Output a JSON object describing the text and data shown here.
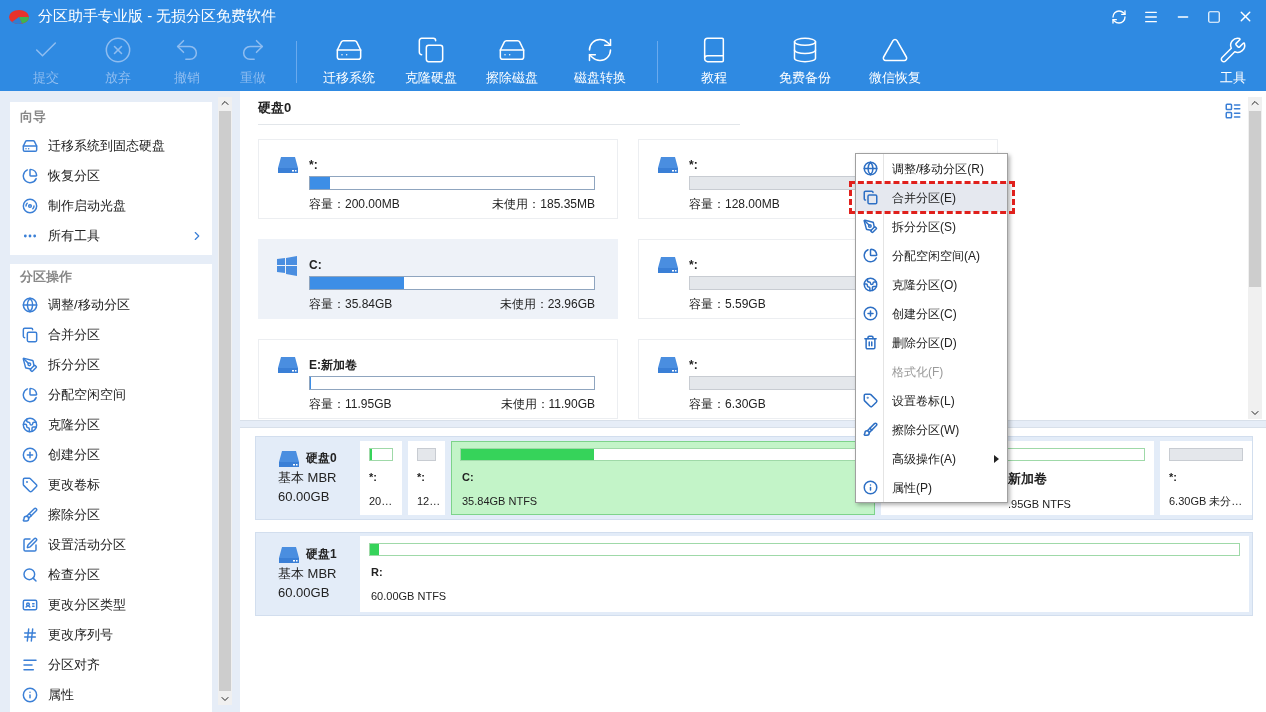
{
  "window": {
    "title": "分区助手专业版 - 无损分区免费软件"
  },
  "toolbar": {
    "groups": [
      [
        {
          "label": "提交",
          "disabled": true
        },
        {
          "label": "放弃",
          "disabled": true
        },
        {
          "label": "撤销",
          "disabled": true
        },
        {
          "label": "重做",
          "disabled": true
        }
      ],
      [
        {
          "label": "迁移系统",
          "disabled": false
        },
        {
          "label": "克隆硬盘",
          "disabled": false
        },
        {
          "label": "擦除磁盘",
          "disabled": false
        },
        {
          "label": "磁盘转换",
          "disabled": false
        }
      ],
      [
        {
          "label": "教程",
          "disabled": false
        },
        {
          "label": "免费备份",
          "disabled": false
        },
        {
          "label": "微信恢复",
          "disabled": false
        }
      ]
    ],
    "tools": {
      "label": "工具"
    }
  },
  "sidebar": {
    "sections": [
      {
        "title": "向导",
        "items": [
          {
            "label": "迁移系统到固态硬盘",
            "kind": "action"
          },
          {
            "label": "恢复分区",
            "kind": "action"
          },
          {
            "label": "制作启动光盘",
            "kind": "action"
          },
          {
            "label": "所有工具",
            "kind": "submenu"
          }
        ]
      },
      {
        "title": "分区操作",
        "items": [
          {
            "label": "调整/移动分区",
            "kind": "action"
          },
          {
            "label": "合并分区",
            "kind": "action"
          },
          {
            "label": "拆分分区",
            "kind": "action"
          },
          {
            "label": "分配空闲空间",
            "kind": "action"
          },
          {
            "label": "克隆分区",
            "kind": "action"
          },
          {
            "label": "创建分区",
            "kind": "action"
          },
          {
            "label": "更改卷标",
            "kind": "action"
          },
          {
            "label": "擦除分区",
            "kind": "action"
          },
          {
            "label": "设置活动分区",
            "kind": "action"
          },
          {
            "label": "检查分区",
            "kind": "action"
          },
          {
            "label": "更改分区类型",
            "kind": "action"
          },
          {
            "label": "更改序列号",
            "kind": "action"
          },
          {
            "label": "分区对齐",
            "kind": "action"
          },
          {
            "label": "属性",
            "kind": "action"
          }
        ]
      }
    ]
  },
  "disk_view": {
    "title": "硬盘0",
    "partitions": [
      {
        "name": "*:",
        "kind": "volume",
        "level": 0.07,
        "capacity": "容量：200.00MB",
        "free": "未使用：185.35MB",
        "selected": false
      },
      {
        "name": "*:",
        "kind": "unallocated",
        "capacity": "容量：128.00MB",
        "selected": false
      },
      {
        "name": "C:",
        "kind": "system",
        "level": 0.33,
        "capacity": "容量：35.84GB",
        "free": "未使用：23.96GB",
        "selected": true
      },
      {
        "name": "*:",
        "kind": "unallocated",
        "capacity": "容量：5.59GB",
        "selected": false
      },
      {
        "name": "E:新加卷",
        "kind": "volume",
        "level": 0.004,
        "capacity": "容量：11.95GB",
        "free": "未使用：11.90GB",
        "selected": false
      },
      {
        "name": "*:",
        "kind": "unallocated",
        "capacity": "容量：6.30GB",
        "selected": false
      }
    ]
  },
  "disk_map": {
    "disks": [
      {
        "name": "硬盘0",
        "type": "基本 MBR",
        "size": "60.00GB",
        "partitions": [
          {
            "name": "*:",
            "size": "20…",
            "kind": "volume",
            "level": 0.08,
            "selected": false
          },
          {
            "name": "*:",
            "size": "12…",
            "kind": "unallocated",
            "selected": false
          },
          {
            "name": "C:",
            "size": "35.84GB NTFS",
            "kind": "volume",
            "level": 0.33,
            "selected": true
          },
          {
            "name": "新加卷",
            "size": ".95GB NTFS",
            "kind": "volume",
            "selected": false
          },
          {
            "name": "*:",
            "size": "6.30GB 未分…",
            "kind": "unallocated",
            "selected": false
          }
        ]
      },
      {
        "name": "硬盘1",
        "type": "基本 MBR",
        "size": "60.00GB",
        "partitions": [
          {
            "name": "R:",
            "size": "60.00GB NTFS",
            "kind": "volume",
            "level": 0.01,
            "selected": false
          }
        ]
      }
    ]
  },
  "context_menu": {
    "items": [
      {
        "label": "调整/移动分区(R)",
        "kind": "item",
        "disabled": false,
        "selected": false
      },
      {
        "label": "合并分区(E)",
        "kind": "item",
        "disabled": false,
        "selected": true
      },
      {
        "label": "拆分分区(S)",
        "kind": "item",
        "disabled": false,
        "selected": false
      },
      {
        "label": "分配空闲空间(A)",
        "kind": "item",
        "disabled": false,
        "selected": false
      },
      {
        "label": "克隆分区(O)",
        "kind": "item",
        "disabled": false,
        "selected": false
      },
      {
        "label": "创建分区(C)",
        "kind": "item",
        "disabled": false,
        "selected": false
      },
      {
        "label": "删除分区(D)",
        "kind": "item",
        "disabled": false,
        "selected": false
      },
      {
        "label": "格式化(F)",
        "kind": "item",
        "disabled": true,
        "selected": false
      },
      {
        "label": "设置卷标(L)",
        "kind": "item",
        "disabled": false,
        "selected": false
      },
      {
        "label": "擦除分区(W)",
        "kind": "item",
        "disabled": false,
        "selected": false
      },
      {
        "label": "高级操作(A)",
        "kind": "submenu",
        "disabled": false,
        "selected": false
      },
      {
        "label": "属性(P)",
        "kind": "item",
        "disabled": false,
        "selected": false
      }
    ]
  }
}
